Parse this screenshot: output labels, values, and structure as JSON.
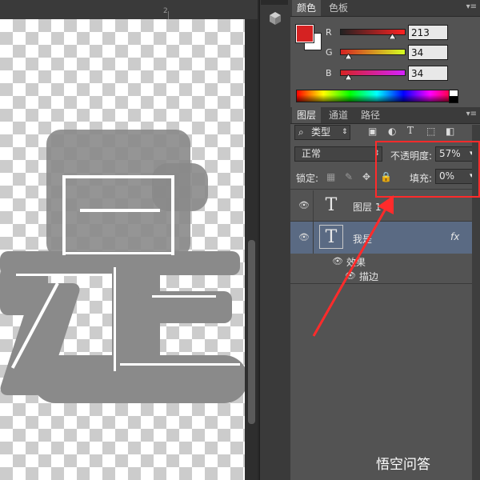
{
  "ruler": {
    "mark": "2"
  },
  "color_panel": {
    "tabs": [
      "颜色",
      "色板"
    ],
    "foreground": "#d52222",
    "background": "#ffffff",
    "channels": [
      {
        "label": "R",
        "value": "213"
      },
      {
        "label": "G",
        "value": "34"
      },
      {
        "label": "B",
        "value": "34"
      }
    ]
  },
  "layers_panel": {
    "tabs": [
      "图层",
      "通道",
      "路径"
    ],
    "filter_kind": "类型",
    "blend_mode": "正常",
    "opacity_label": "不透明度:",
    "opacity_value": "57%",
    "lock_label": "锁定:",
    "fill_label": "填充:",
    "fill_value": "0%",
    "layers": [
      {
        "name": "图层 1",
        "thumb": "T"
      },
      {
        "name": "我是",
        "thumb": "T",
        "fx": "fx"
      }
    ],
    "effects_label": "效果",
    "effect_item": "描边"
  },
  "watermark": "悟空问答",
  "colors": {
    "highlight": "#ff2b2b",
    "selected_layer": "#5a6a83",
    "panel": "#535353"
  }
}
